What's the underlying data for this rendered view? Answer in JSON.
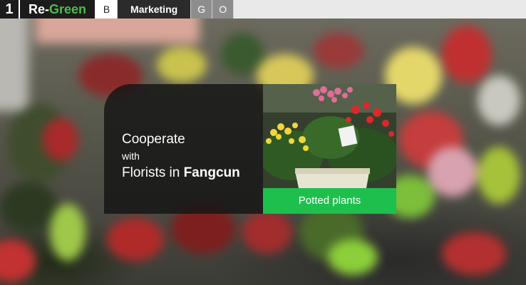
{
  "topbar": {
    "logo_number": "1",
    "logo_name_main": "Re-",
    "logo_name_accent": "Green",
    "nav": [
      {
        "label": "B"
      },
      {
        "label": "Marketing"
      },
      {
        "label": "G"
      },
      {
        "label": "O"
      }
    ]
  },
  "hero": {
    "line1": "Cooperate",
    "line2": "with",
    "line3_prefix": "Florists in ",
    "line3_bold": "Fangcun",
    "photo_caption": "Potted plants"
  },
  "colors": {
    "brand_green": "#4cbd4c",
    "caption_green": "#1fbf4e"
  }
}
